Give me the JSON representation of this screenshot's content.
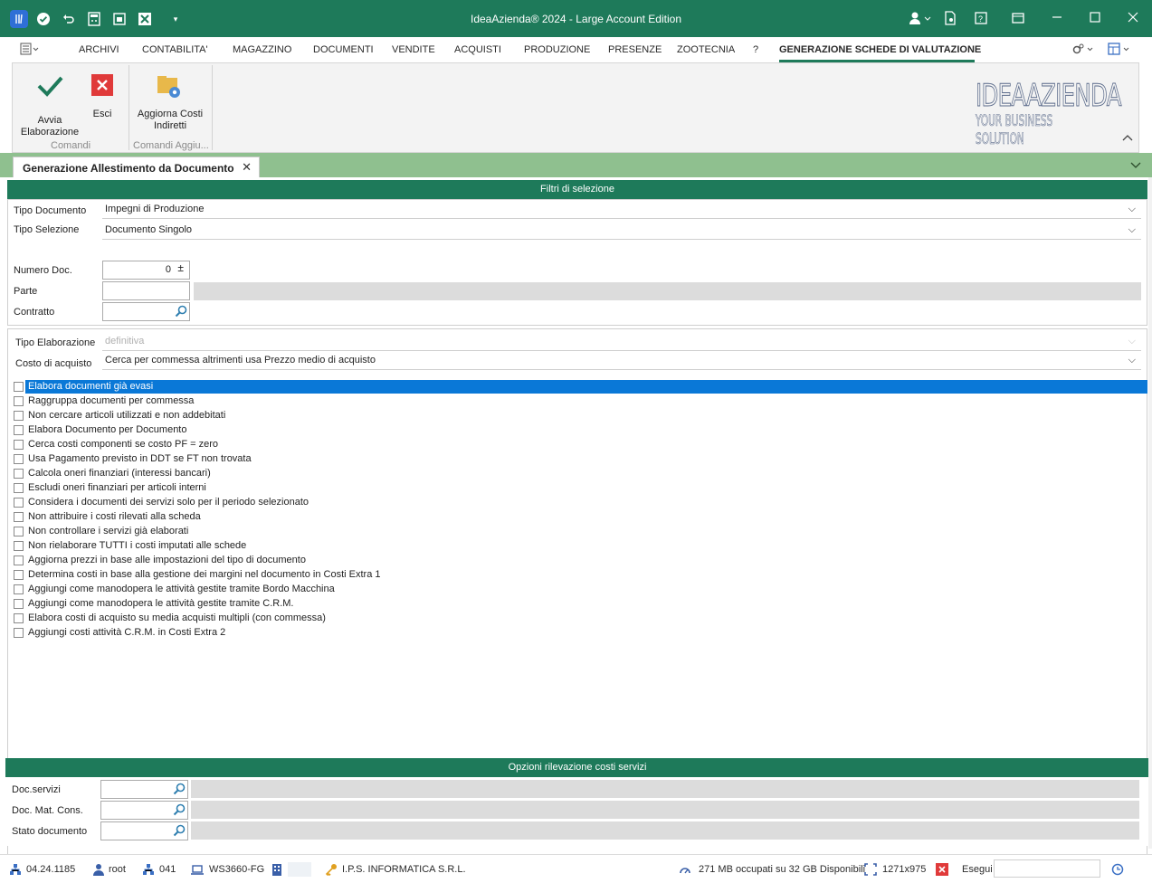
{
  "window": {
    "title": "IdeaAzienda® 2024 - Large Account Edition",
    "accent": "#1e7a5a"
  },
  "quick_access": [
    "app-icon",
    "confirm-icon",
    "undo-icon",
    "calculator-icon",
    "print-icon",
    "excel-icon",
    "customize-icon"
  ],
  "menu": {
    "items": [
      "ARCHIVI",
      "CONTABILITA'",
      "MAGAZZINO",
      "DOCUMENTI",
      "VENDITE",
      "ACQUISTI",
      "PRODUZIONE",
      "PRESENZE",
      "ZOOTECNIA",
      "?",
      "GENERAZIONE SCHEDE DI VALUTAZIONE"
    ]
  },
  "ribbon": {
    "avvia": "Avvia\nElaborazione",
    "avvia_l1": "Avvia",
    "avvia_l2": "Elaborazione",
    "esci": "Esci",
    "aggiorna_l1": "Aggiorna Costi",
    "aggiorna_l2": "Indiretti",
    "group1": "Comandi",
    "group2": "Comandi Aggiu..."
  },
  "logo": {
    "line1": "IDEAAZIENDA",
    "line2": "YOUR BUSINESS SOLUTION"
  },
  "tab": {
    "label": "Generazione Allestimento da Documento"
  },
  "filtri": {
    "header": "Filtri di selezione",
    "tipo_documento_label": "Tipo Documento",
    "tipo_documento_value": "Impegni di Produzione",
    "tipo_selezione_label": "Tipo Selezione",
    "tipo_selezione_value": "Documento Singolo",
    "numero_doc_label": "Numero Doc.",
    "numero_doc_value": "0",
    "parte_label": "Parte",
    "contratto_label": "Contratto",
    "tipo_elaborazione_label": "Tipo Elaborazione",
    "tipo_elaborazione_value": "definitiva",
    "costo_acquisto_label": "Costo di acquisto",
    "costo_acquisto_value": "Cerca per commessa altrimenti usa Prezzo medio di acquisto"
  },
  "options": [
    "Elabora documenti già evasi",
    "Raggruppa documenti per commessa",
    "Non cercare articoli utilizzati e non addebitati",
    "Elabora Documento per Documento",
    "Cerca costi componenti se costo PF = zero",
    "Usa Pagamento previsto in DDT se FT non trovata",
    "Calcola oneri finanziari (interessi bancari)",
    "Escludi oneri finanziari per articoli interni",
    "Considera i documenti dei servizi solo per il periodo selezionato",
    "Non attribuire i costi rilevati alla scheda",
    "Non controllare i servizi già elaborati",
    "Non rielaborare TUTTI i costi imputati alle schede",
    "Aggiorna prezzi in base alle impostazioni del tipo di documento",
    "Determina costi in base alla gestione dei margini nel documento in Costi Extra 1",
    "Aggiungi come manodopera le attività gestite tramite Bordo Macchina",
    "Aggiungi come manodopera le attività gestite tramite C.R.M.",
    "Elabora costi di acquisto su media acquisti multipli (con commessa)",
    "Aggiungi costi attività C.R.M. in Costi Extra 2"
  ],
  "servizi": {
    "header": "Opzioni rilevazione costi servizi",
    "doc_servizi_label": "Doc.servizi",
    "doc_mat_cons_label": "Doc. Mat. Cons.",
    "stato_documento_label": "Stato documento"
  },
  "status": {
    "version": "04.24.1185",
    "user": "root",
    "company_code": "041",
    "workstation": "WS3660-FG",
    "company": "I.P.S. INFORMATICA S.R.L.",
    "memory": "271 MB occupati su 32 GB Disponibili",
    "resolution": "1271x975",
    "esegui": "Esegui"
  }
}
